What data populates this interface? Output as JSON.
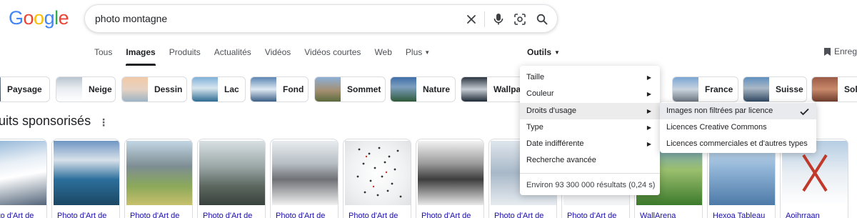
{
  "header": {
    "logo": [
      "G",
      "o",
      "o",
      "g",
      "l",
      "e"
    ],
    "logo_colors": [
      "#4285F4",
      "#EA4335",
      "#FBBC05",
      "#4285F4",
      "#34A853",
      "#EA4335"
    ],
    "search_value": "photo montagne"
  },
  "tabs": [
    {
      "label": "Tous"
    },
    {
      "label": "Images"
    },
    {
      "label": "Produits"
    },
    {
      "label": "Actualités"
    },
    {
      "label": "Vidéos"
    },
    {
      "label": "Vidéos courtes"
    },
    {
      "label": "Web"
    },
    {
      "label": "Plus"
    }
  ],
  "tools_label": "Outils",
  "save_label": "Enregi",
  "chips": [
    {
      "label": "Paysage"
    },
    {
      "label": "Neige"
    },
    {
      "label": "Dessin"
    },
    {
      "label": "Lac"
    },
    {
      "label": "Fond"
    },
    {
      "label": "Sommet"
    },
    {
      "label": "Nature"
    },
    {
      "label": "Wallpap"
    },
    {
      "label": "France"
    },
    {
      "label": "Suisse"
    },
    {
      "label": "Sol"
    }
  ],
  "section": {
    "title": "duits sponsorisés",
    "menu": "⋮"
  },
  "products": [
    {
      "title": "Photo d'Art de"
    },
    {
      "title": "Photo d'Art de"
    },
    {
      "title": "Photo d'Art de"
    },
    {
      "title": "Photo d'Art de"
    },
    {
      "title": "Photo d'Art de"
    },
    {
      "title": "Photo d'Art de"
    },
    {
      "title": "Photo d'Art de"
    },
    {
      "title": "Photo d'Art de"
    },
    {
      "title": "Photo d'Art de"
    },
    {
      "title": "WallArena"
    },
    {
      "title": "Hexoa Tableau"
    },
    {
      "title": "Aoihrraan"
    }
  ],
  "tools_menu": {
    "items": [
      {
        "label": "Taille"
      },
      {
        "label": "Couleur"
      },
      {
        "label": "Droits d'usage"
      },
      {
        "label": "Type"
      },
      {
        "label": "Date indifférente"
      },
      {
        "label": "Recherche avancée"
      }
    ],
    "result_stats": "Environ 93 300 000 résultats (0,24 s)"
  },
  "rights_menu": {
    "items": [
      {
        "label": "Images non filtrées par licence"
      },
      {
        "label": "Licences Creative Commons"
      },
      {
        "label": "Licences commerciales et d'autres types"
      }
    ]
  }
}
